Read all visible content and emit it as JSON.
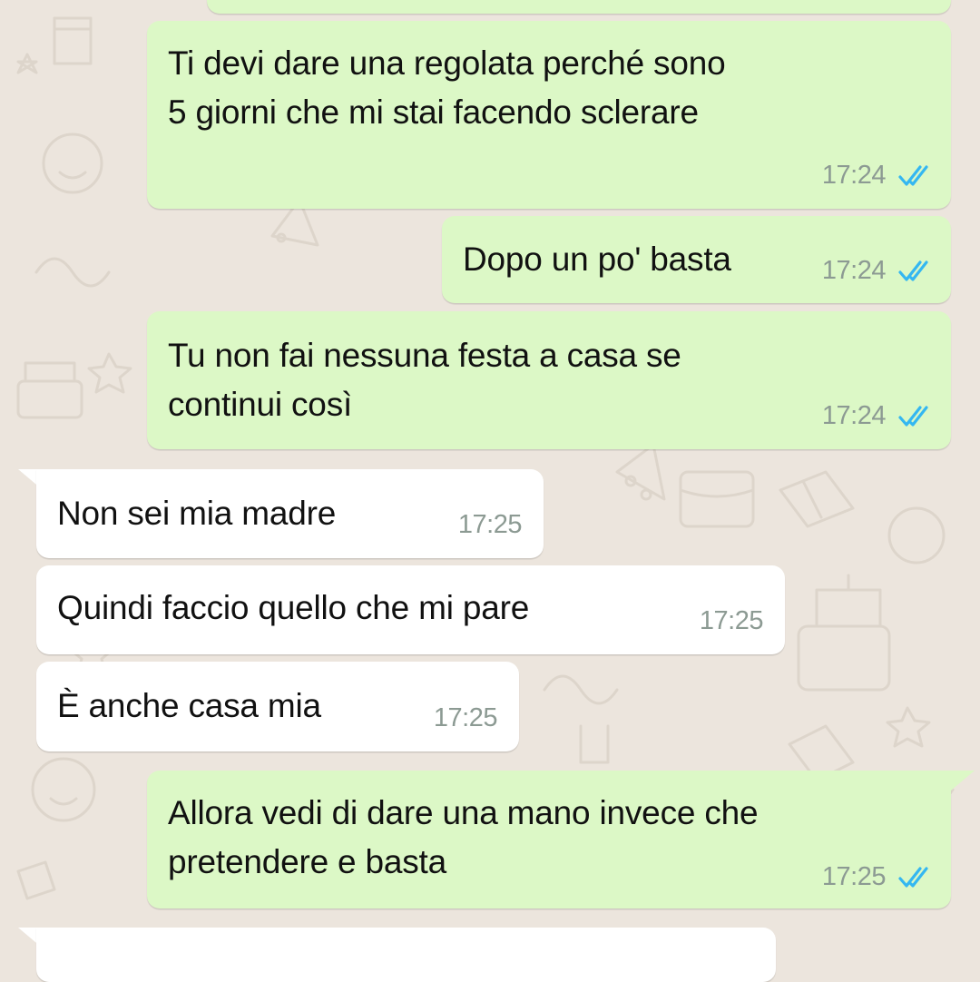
{
  "colors": {
    "outgoing_bubble": "#dcf8c6",
    "incoming_bubble": "#ffffff",
    "chat_background": "#ece5dd",
    "timestamp": "#8c9a93",
    "read_ticks": "#34b7f1"
  },
  "messages": [
    {
      "direction": "outgoing",
      "text": "Ti devi dare una regolata perché sono\n5 giorni che mi stai facendo sclerare",
      "time": "17:24",
      "status": "read"
    },
    {
      "direction": "outgoing",
      "text": "Dopo un po' basta",
      "time": "17:24",
      "status": "read"
    },
    {
      "direction": "outgoing",
      "text": "Tu non fai nessuna festa a casa se\ncontinui così",
      "time": "17:24",
      "status": "read"
    },
    {
      "direction": "incoming",
      "text": "Non sei mia madre",
      "time": "17:25"
    },
    {
      "direction": "incoming",
      "text": "Quindi faccio quello che mi pare",
      "time": "17:25"
    },
    {
      "direction": "incoming",
      "text": "È anche casa mia",
      "time": "17:25"
    },
    {
      "direction": "outgoing",
      "text": "Allora vedi di dare una mano invece che\npretendere e basta",
      "time": "17:25",
      "status": "read"
    }
  ],
  "icons": {
    "read_status": "double-check-icon",
    "wallpaper": "doodle-pattern"
  }
}
